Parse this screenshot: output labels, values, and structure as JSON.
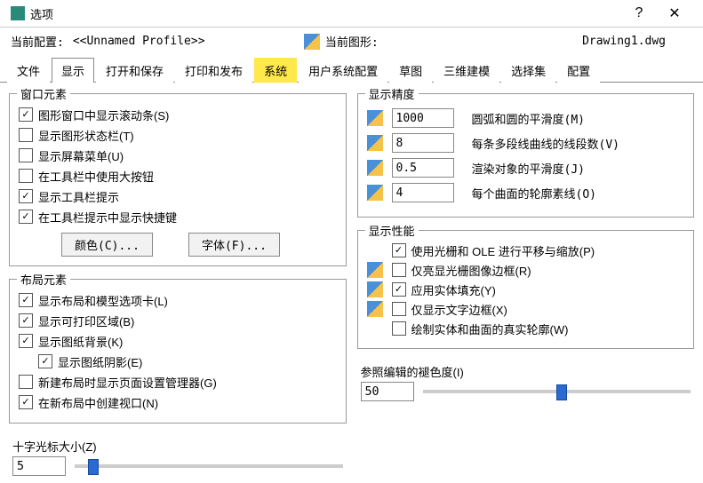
{
  "window": {
    "title": "选项",
    "help": "?",
    "close": "✕"
  },
  "header": {
    "profile_label": "当前配置:",
    "profile_value": "<<Unnamed Profile>>",
    "drawing_label": "当前图形:",
    "drawing_value": "Drawing1.dwg"
  },
  "tabs": [
    "文件",
    "显示",
    "打开和保存",
    "打印和发布",
    "系统",
    "用户系统配置",
    "草图",
    "三维建模",
    "选择集",
    "配置"
  ],
  "active_tab": 1,
  "highlight_tab": 4,
  "win_elements": {
    "legend": "窗口元素",
    "scrollbar": "图形窗口中显示滚动条(S)",
    "statusbar": "显示图形状态栏(T)",
    "screenmenu": "显示屏幕菜单(U)",
    "largebtn": "在工具栏中使用大按钮",
    "tooltips": "显示工具栏提示",
    "shortcut": "在工具栏提示中显示快捷键",
    "color_btn": "颜色(C)...",
    "font_btn": "字体(F)..."
  },
  "layout_elements": {
    "legend": "布局元素",
    "layout_tabs": "显示布局和模型选项卡(L)",
    "printable": "显示可打印区域(B)",
    "paperbg": "显示图纸背景(K)",
    "papershadow": "显示图纸阴影(E)",
    "pagesetup": "新建布局时显示页面设置管理器(G)",
    "viewport": "在新布局中创建视口(N)"
  },
  "precision": {
    "legend": "显示精度",
    "arc": {
      "value": "1000",
      "label": "圆弧和圆的平滑度(M)"
    },
    "segments": {
      "value": "8",
      "label": "每条多段线曲线的线段数(V)"
    },
    "render": {
      "value": "0.5",
      "label": "渲染对象的平滑度(J)"
    },
    "contour": {
      "value": "4",
      "label": "每个曲面的轮廓素线(O)"
    }
  },
  "performance": {
    "legend": "显示性能",
    "raster_ole": "使用光栅和 OLE 进行平移与缩放(P)",
    "raster_frame": "仅亮显光栅图像边框(R)",
    "solid_fill": "应用实体填充(Y)",
    "text_frame": "仅显示文字边框(X)",
    "true_sil": "绘制实体和曲面的真实轮廓(W)"
  },
  "crosshair": {
    "label": "十字光标大小(Z)",
    "value": "5",
    "pct": 5
  },
  "refedit": {
    "label": "参照编辑的褪色度(I)",
    "value": "50",
    "pct": 50
  },
  "chart_data": null
}
